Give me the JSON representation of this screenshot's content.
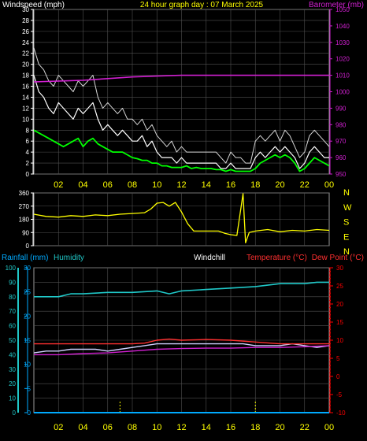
{
  "colors": {
    "background": "#000000",
    "panel_border": "#9a9a9a",
    "grid": "#505050",
    "speed_axis": "#ffffff",
    "baro_axis": "#d020d0",
    "time_axis": "#ffff00",
    "wind_speed": "#ffffff",
    "wind_gust": "#d8d8d8",
    "wind_avg": "#00ff00",
    "barometer": "#d020d0",
    "wind_direction": "#ffff00",
    "rainfall": "#00aaff",
    "humidity": "#20c8c8",
    "windchill": "#d0d0ff",
    "temperature": "#ff3030",
    "dew_point": "#d020d0",
    "rain_axis": "#00aaff",
    "humidity_axis": "#20c8c8",
    "temp_axis": "#ff0000"
  },
  "chart_data": [
    {
      "type": "line",
      "title": "24 hour graph day : 07 March 2025",
      "ylabel_left": "Windspeed (mph)",
      "ylabel_right": "Barometer (mb)",
      "x_ticks": [
        "02",
        "04",
        "06",
        "08",
        "10",
        "12",
        "14",
        "16",
        "18",
        "20",
        "22",
        "00"
      ],
      "y_left_ticks": [
        "0",
        "2",
        "4",
        "6",
        "8",
        "10",
        "12",
        "14",
        "16",
        "18",
        "20",
        "22",
        "24",
        "26",
        "28",
        "30"
      ],
      "y_right_ticks": [
        "950",
        "960",
        "970",
        "980",
        "990",
        "1000",
        "1010",
        "1020",
        "1030",
        "1040",
        "1050"
      ],
      "ylim_left": [
        0,
        30
      ],
      "ylim_right": [
        950,
        1050
      ],
      "xlim_hours": [
        0,
        24
      ],
      "grid": true,
      "series": [
        {
          "name": "Windspeed (mph)",
          "axis": "left",
          "x": [
            0,
            0.4,
            0.8,
            1.2,
            1.6,
            2,
            2.4,
            2.8,
            3.2,
            3.6,
            4,
            4.4,
            4.8,
            5.2,
            5.6,
            6,
            6.4,
            6.8,
            7.2,
            7.6,
            8,
            8.4,
            8.8,
            9.2,
            9.6,
            10,
            10.4,
            10.8,
            11.2,
            11.6,
            12,
            12.4,
            12.8,
            13.2,
            13.6,
            14,
            14.4,
            14.8,
            15.2,
            15.6,
            16,
            16.4,
            16.8,
            17.2,
            17.6,
            18,
            18.4,
            18.8,
            19.2,
            19.6,
            20,
            20.4,
            20.8,
            21.2,
            21.6,
            22,
            22.4,
            22.8,
            23.2,
            23.6,
            24
          ],
          "y": [
            18,
            15,
            14,
            12,
            11,
            13,
            12,
            11,
            10,
            12,
            11,
            12,
            13,
            10,
            8,
            9,
            8,
            7,
            8,
            7,
            6,
            6,
            7,
            5,
            6,
            4,
            3,
            3,
            3,
            2,
            3,
            2,
            2,
            2,
            2,
            2,
            2,
            2,
            1,
            1,
            2,
            1,
            1,
            1,
            1,
            3,
            4,
            3,
            4,
            5,
            4,
            5,
            4,
            3,
            1,
            2,
            4,
            5,
            4,
            3,
            3
          ]
        },
        {
          "name": "Gust (mph)",
          "axis": "left",
          "x": [
            0,
            0.4,
            0.8,
            1.2,
            1.6,
            2,
            2.4,
            2.8,
            3.2,
            3.6,
            4,
            4.4,
            4.8,
            5.2,
            5.6,
            6,
            6.4,
            6.8,
            7.2,
            7.6,
            8,
            8.4,
            8.8,
            9.2,
            9.6,
            10,
            10.4,
            10.8,
            11.2,
            11.6,
            12,
            12.4,
            12.8,
            13.2,
            13.6,
            14,
            14.4,
            14.8,
            15.2,
            15.6,
            16,
            16.4,
            16.8,
            17.2,
            17.6,
            18,
            18.4,
            18.8,
            19.2,
            19.6,
            20,
            20.4,
            20.8,
            21.2,
            21.6,
            22,
            22.4,
            22.8,
            23.2,
            23.6,
            24
          ],
          "y": [
            23,
            20,
            19,
            17,
            16,
            18,
            17,
            16,
            15,
            17,
            16,
            17,
            18,
            14,
            12,
            13,
            12,
            11,
            12,
            10,
            10,
            9,
            10,
            8,
            9,
            7,
            6,
            5,
            6,
            4,
            5,
            4,
            4,
            4,
            4,
            4,
            4,
            4,
            3,
            2,
            4,
            3,
            3,
            2,
            2,
            6,
            7,
            6,
            7,
            8,
            6,
            8,
            7,
            5,
            3,
            4,
            7,
            8,
            7,
            6,
            5
          ]
        },
        {
          "name": "Average (mph)",
          "axis": "left",
          "x": [
            0,
            0.4,
            0.8,
            1.2,
            1.6,
            2,
            2.4,
            2.8,
            3.2,
            3.6,
            4,
            4.4,
            4.8,
            5.2,
            5.6,
            6,
            6.4,
            6.8,
            7.2,
            7.6,
            8,
            8.4,
            8.8,
            9.2,
            9.6,
            10,
            10.4,
            10.8,
            11.2,
            11.6,
            12,
            12.4,
            12.8,
            13.2,
            13.6,
            14,
            14.4,
            14.8,
            15.2,
            15.6,
            16,
            16.4,
            16.8,
            17.2,
            17.6,
            18,
            18.4,
            18.8,
            19.2,
            19.6,
            20,
            20.4,
            20.8,
            21.2,
            21.6,
            22,
            22.4,
            22.8,
            23.2,
            23.6,
            24
          ],
          "y": [
            8,
            7.5,
            7,
            6.5,
            6,
            5.5,
            5,
            5.5,
            6,
            6.5,
            5,
            6,
            6.5,
            5.5,
            5,
            4.5,
            4,
            4,
            4,
            3.5,
            3,
            2.8,
            2.5,
            2.5,
            2,
            2,
            1.5,
            1.5,
            1.2,
            1.2,
            1.2,
            1.5,
            1,
            1.2,
            1,
            1,
            1,
            0.8,
            0.8,
            0.5,
            0.8,
            0.5,
            0.5,
            0.5,
            0.5,
            1,
            2,
            2.5,
            3,
            3.5,
            3,
            3.5,
            3,
            2,
            0.5,
            1,
            2,
            3,
            2.5,
            2,
            1.5
          ]
        },
        {
          "name": "Barometer (mb)",
          "axis": "right",
          "x": [
            0,
            2,
            4,
            6,
            8,
            10,
            12,
            14,
            16,
            18,
            20,
            22,
            24
          ],
          "y": [
            1006,
            1006.5,
            1007,
            1008,
            1009,
            1009.5,
            1010,
            1010,
            1010,
            1010,
            1010,
            1010,
            1010
          ]
        }
      ]
    },
    {
      "type": "line",
      "title": "",
      "y_ticks": [
        "360",
        "270",
        "180",
        "90",
        "0"
      ],
      "ylim": [
        0,
        360
      ],
      "compass_labels": [
        "N",
        "W",
        "S",
        "E",
        "N"
      ],
      "grid": true,
      "series": [
        {
          "name": "Wind direction",
          "x": [
            0,
            1,
            2,
            3,
            4,
            5,
            6,
            7,
            8,
            9,
            9.5,
            10,
            10.5,
            11,
            11.5,
            12,
            12.5,
            13,
            14,
            15,
            15.5,
            16,
            16.5,
            17,
            17.2,
            17.5,
            18,
            19,
            20,
            21,
            22,
            23,
            24
          ],
          "y": [
            215,
            200,
            195,
            205,
            200,
            210,
            205,
            215,
            220,
            225,
            250,
            290,
            295,
            270,
            295,
            230,
            150,
            100,
            100,
            100,
            85,
            75,
            70,
            355,
            20,
            90,
            100,
            110,
            95,
            105,
            100,
            110,
            105
          ]
        }
      ]
    },
    {
      "type": "line",
      "legend": [
        "Rainfall (mm)",
        "Humidity",
        "Windchill",
        "Temperature (°C)",
        "Dew Point (°C)"
      ],
      "x_ticks": [
        "02",
        "04",
        "06",
        "08",
        "10",
        "12",
        "14",
        "16",
        "18",
        "20",
        "22",
        "00"
      ],
      "y_humidity_ticks": [
        "0",
        "10",
        "20",
        "30",
        "40",
        "50",
        "60",
        "70",
        "80",
        "90",
        "100"
      ],
      "y_rain_ticks": [
        "0",
        "5",
        "10",
        "15",
        "20",
        "25",
        "30"
      ],
      "y_temp_ticks": [
        "-10",
        "-5",
        "0",
        "5",
        "10",
        "15",
        "20",
        "25",
        "30"
      ],
      "ylim_humidity": [
        0,
        100
      ],
      "ylim_rain": [
        0,
        30
      ],
      "ylim_temp": [
        -10,
        30
      ],
      "grid": true,
      "series": [
        {
          "name": "Rainfall (mm)",
          "axis": "rain",
          "x": [
            0,
            24
          ],
          "y": [
            0,
            0
          ]
        },
        {
          "name": "Humidity",
          "axis": "humidity",
          "x": [
            0,
            2,
            3,
            4,
            6,
            8,
            10,
            11,
            12,
            14,
            16,
            18,
            20,
            22,
            23,
            24
          ],
          "y": [
            80,
            80,
            82,
            82,
            83,
            83,
            84,
            82,
            84,
            85,
            86,
            87,
            89,
            89,
            90,
            90
          ]
        },
        {
          "name": "Windchill",
          "axis": "temp",
          "x": [
            0,
            1,
            2,
            3,
            4,
            5,
            6,
            7,
            8,
            9,
            10,
            11,
            12,
            13,
            14,
            15,
            16,
            17,
            18,
            19,
            20,
            21,
            22,
            23,
            24
          ],
          "y": [
            6.5,
            7,
            7,
            7.5,
            7.5,
            7.5,
            7,
            7.5,
            8,
            8.5,
            9,
            9,
            9,
            9,
            9,
            9,
            9,
            9,
            8.5,
            8.5,
            8.5,
            9,
            8.5,
            8,
            8.5
          ]
        },
        {
          "name": "Temperature (°C)",
          "axis": "temp",
          "x": [
            0,
            2,
            4,
            6,
            8,
            9,
            10,
            11,
            12,
            14,
            16,
            18,
            20,
            22,
            24
          ],
          "y": [
            9,
            9,
            9,
            9,
            9,
            9.2,
            10,
            10.3,
            10,
            10.2,
            10,
            9.5,
            9,
            9,
            9
          ]
        },
        {
          "name": "Dew Point (°C)",
          "axis": "temp",
          "x": [
            0,
            2,
            4,
            6,
            8,
            10,
            12,
            14,
            16,
            18,
            20,
            22,
            24
          ],
          "y": [
            6,
            6,
            6.3,
            6.5,
            7,
            7.5,
            7.7,
            7.8,
            7.8,
            8,
            8,
            8.2,
            8.5
          ]
        }
      ]
    }
  ]
}
